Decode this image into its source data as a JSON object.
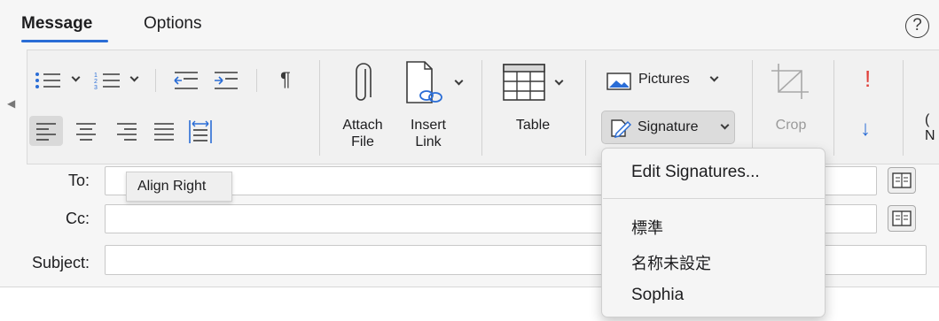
{
  "tabs": {
    "message": "Message",
    "options": "Options"
  },
  "help": {
    "label": "?"
  },
  "toolbar": {
    "paragraph_mark": "¶",
    "attach_line1": "Attach",
    "attach_line2": "File",
    "insert_line1": "Insert",
    "insert_line2": "Link",
    "table": "Table",
    "pictures": "Pictures",
    "signature": "Signature",
    "crop": "Crop",
    "importance_high": "!",
    "importance_low": "↓",
    "next_partial_top": "(",
    "next_partial_bottom": "N"
  },
  "form": {
    "to_label": "To:",
    "cc_label": "Cc:",
    "subject_label": "Subject:",
    "to_value": "",
    "cc_value": "",
    "subject_value": ""
  },
  "tooltip": {
    "text": "Align Right"
  },
  "signature_menu": {
    "edit": "Edit Signatures...",
    "items": [
      "標準",
      "名称未設定",
      "Sophia"
    ]
  },
  "colors": {
    "accent": "#2a6dd6",
    "importance_high": "#e0403a",
    "importance_low": "#2a6dd6",
    "icon": "#3a3a3a",
    "icon_blue": "#2a6dd6"
  },
  "icons": {
    "bullets": "bullet-list-icon",
    "numbering": "numbered-list-icon",
    "outdent": "decrease-indent-icon",
    "indent": "increase-indent-icon",
    "align_left": "align-left-icon",
    "center": "align-center-icon",
    "align_right": "align-right-icon",
    "justify": "justify-icon",
    "distributed": "distributed-icon",
    "attach": "paperclip-icon",
    "link": "link-icon",
    "table": "table-icon",
    "pictures": "picture-icon",
    "signature": "signature-icon",
    "crop": "crop-icon",
    "address_book": "address-book-icon"
  }
}
